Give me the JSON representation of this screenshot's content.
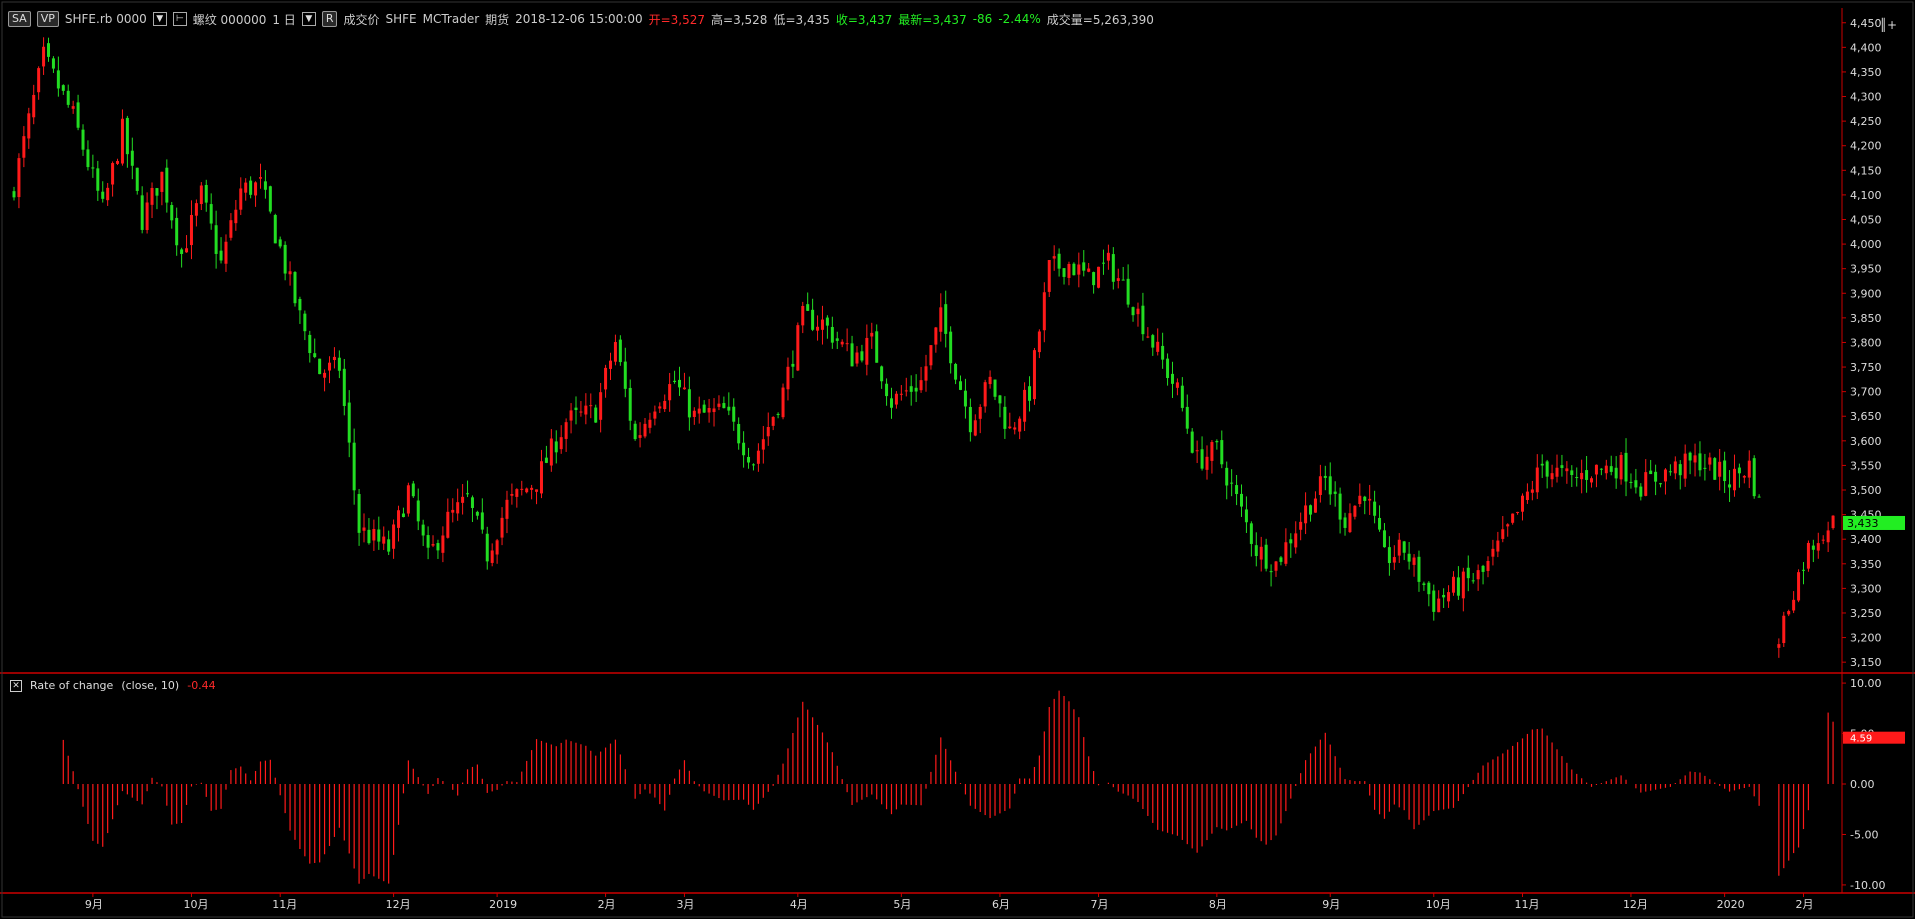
{
  "header": {
    "symbol_button": "SA",
    "vp_button": "VP",
    "symbol": "SHFE.rb 0000",
    "name": "螺纹 000000",
    "interval": "1 日",
    "r_button": "R",
    "price_type": "成交价",
    "exchange": "SHFE",
    "source": "MCTrader",
    "category": "期货",
    "datetime": "2018-12-06 15:00:00",
    "open": "开=3,527",
    "high": "高=3,528",
    "low": "低=3,435",
    "close": "收=3,437",
    "last": "最新=3,437",
    "change": "-86",
    "change_pct": "-2.44%",
    "volume": "成交量=5,263,390"
  },
  "corner_button": "║+",
  "indicator": {
    "close_icon": "✕",
    "name": "Rate of change",
    "params": "(close,  10)",
    "value": "-0.44"
  },
  "colors": {
    "up": "#ff1a1a",
    "down": "#22dd22",
    "grid": "#cc0000",
    "axis_text": "#dddddd",
    "roc": "#ff1a1a",
    "last_price_bg": "#22ee22",
    "last_roc_bg": "#ff1a1a"
  },
  "chart_data": [
    {
      "type": "candlestick",
      "y_ticks": [
        3150,
        3200,
        3250,
        3300,
        3350,
        3400,
        3450,
        3500,
        3550,
        3600,
        3650,
        3700,
        3750,
        3800,
        3850,
        3900,
        3950,
        4000,
        4050,
        4100,
        4150,
        4200,
        4250,
        4300,
        4350,
        4400,
        4450
      ],
      "ylim": [
        3130,
        4480
      ],
      "x_labels": [
        "9月",
        "10月",
        "11月",
        "12月",
        "2019",
        "2月",
        "3月",
        "4月",
        "5月",
        "6月",
        "7月",
        "8月",
        "9月",
        "10月",
        "11月",
        "12月",
        "2020",
        "2月"
      ],
      "x_label_bar_index": [
        16,
        36,
        54,
        77,
        98,
        120,
        136,
        159,
        180,
        200,
        220,
        244,
        267,
        288,
        306,
        328,
        347,
        363
      ],
      "n_bars": 370,
      "close_anchors": [
        [
          0,
          4120
        ],
        [
          6,
          4380
        ],
        [
          12,
          4260
        ],
        [
          18,
          4070
        ],
        [
          22,
          4230
        ],
        [
          26,
          4050
        ],
        [
          30,
          4140
        ],
        [
          34,
          3980
        ],
        [
          38,
          4100
        ],
        [
          42,
          3960
        ],
        [
          46,
          4110
        ],
        [
          50,
          4120
        ],
        [
          54,
          3990
        ],
        [
          58,
          3850
        ],
        [
          62,
          3740
        ],
        [
          66,
          3750
        ],
        [
          70,
          3420
        ],
        [
          76,
          3380
        ],
        [
          80,
          3500
        ],
        [
          84,
          3360
        ],
        [
          88,
          3440
        ],
        [
          92,
          3480
        ],
        [
          96,
          3370
        ],
        [
          100,
          3470
        ],
        [
          106,
          3520
        ],
        [
          112,
          3640
        ],
        [
          118,
          3660
        ],
        [
          122,
          3800
        ],
        [
          126,
          3600
        ],
        [
          130,
          3680
        ],
        [
          134,
          3720
        ],
        [
          138,
          3650
        ],
        [
          144,
          3660
        ],
        [
          150,
          3560
        ],
        [
          156,
          3700
        ],
        [
          160,
          3850
        ],
        [
          164,
          3840
        ],
        [
          170,
          3770
        ],
        [
          174,
          3800
        ],
        [
          178,
          3680
        ],
        [
          184,
          3720
        ],
        [
          188,
          3850
        ],
        [
          194,
          3640
        ],
        [
          198,
          3720
        ],
        [
          202,
          3620
        ],
        [
          206,
          3700
        ],
        [
          210,
          3950
        ],
        [
          214,
          3960
        ],
        [
          218,
          3930
        ],
        [
          222,
          3960
        ],
        [
          226,
          3900
        ],
        [
          230,
          3820
        ],
        [
          236,
          3700
        ],
        [
          240,
          3560
        ],
        [
          244,
          3580
        ],
        [
          248,
          3480
        ],
        [
          252,
          3380
        ],
        [
          256,
          3350
        ],
        [
          262,
          3460
        ],
        [
          266,
          3520
        ],
        [
          270,
          3440
        ],
        [
          274,
          3500
        ],
        [
          278,
          3360
        ],
        [
          282,
          3380
        ],
        [
          288,
          3270
        ],
        [
          292,
          3300
        ],
        [
          298,
          3330
        ],
        [
          302,
          3400
        ],
        [
          306,
          3470
        ],
        [
          310,
          3550
        ],
        [
          316,
          3520
        ],
        [
          320,
          3540
        ],
        [
          326,
          3550
        ],
        [
          330,
          3510
        ],
        [
          336,
          3540
        ],
        [
          342,
          3560
        ],
        [
          348,
          3520
        ],
        [
          352,
          3550
        ],
        [
          354,
          3470
        ],
        [
          355,
          null
        ],
        [
          357,
          null
        ],
        [
          358,
          3200
        ],
        [
          361,
          3300
        ],
        [
          364,
          3380
        ],
        [
          367,
          3420
        ],
        [
          369,
          3433
        ]
      ],
      "last_price": "3,433",
      "last_price_value": 3433
    },
    {
      "type": "bar",
      "title": "Rate of change",
      "y_ticks": [
        10.0,
        5.0,
        0.0,
        -5.0,
        -10.0
      ],
      "y_tick_labels": [
        "10.00",
        "5.00",
        "0.00",
        "-5.00",
        "-10.00"
      ],
      "ylim": [
        -10.8,
        11.0
      ],
      "last_value": "4.59",
      "last_value_num": 4.59
    }
  ]
}
